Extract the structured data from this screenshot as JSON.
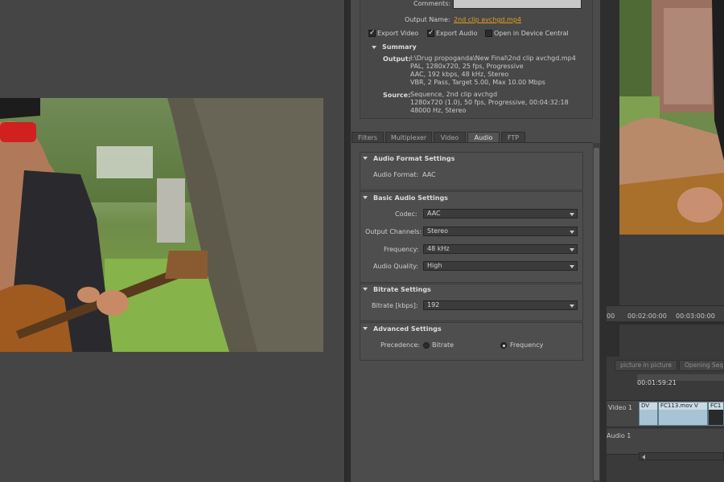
{
  "dialog": {
    "comments_label": "Comments:",
    "comments_value": "",
    "output_name_label": "Output Name:",
    "output_name_value": "2nd clip avchgd.mp4",
    "export_video_label": "Export Video",
    "export_video_checked": true,
    "export_audio_label": "Export Audio",
    "export_audio_checked": true,
    "device_central_label": "Open in Device Central",
    "device_central_checked": false,
    "summary": {
      "title": "Summary",
      "output_label": "Output:",
      "output_lines": [
        "I:\\Drug propoganda\\New Final\\2nd clip avchgd.mp4",
        "PAL, 1280x720, 25 fps, Progressive",
        "AAC, 192 kbps, 48 kHz, Stereo",
        "VBR, 2 Pass, Target 5.00, Max 10.00 Mbps"
      ],
      "source_label": "Source:",
      "source_lines": [
        "Sequence, 2nd clip avchgd",
        "1280x720 (1.0), 50 fps, Progressive, 00:04:32:18",
        "48000 Hz, Stereo"
      ]
    },
    "tabs": [
      "Filters",
      "Multiplexer",
      "Video",
      "Audio",
      "FTP"
    ],
    "active_tab": "Audio",
    "audio_format": {
      "title": "Audio Format Settings",
      "label": "Audio Format:",
      "value": "AAC"
    },
    "basic_audio": {
      "title": "Basic Audio Settings",
      "codec_label": "Codec:",
      "codec_value": "AAC",
      "channels_label": "Output Channels:",
      "channels_value": "Stereo",
      "frequency_label": "Frequency:",
      "frequency_value": "48 kHz",
      "quality_label": "Audio Quality:",
      "quality_value": "High"
    },
    "bitrate": {
      "title": "Bitrate Settings",
      "label": "Bitrate [kbps]:",
      "value": "192"
    },
    "advanced": {
      "title": "Advanced Settings",
      "precedence_label": "Precedence:",
      "option_bitrate": "Bitrate",
      "option_frequency": "Frequency",
      "selected": "Frequency"
    }
  },
  "timeline": {
    "ruler_ticks": [
      "00",
      "00:02:00:00",
      "00:03:00:00"
    ],
    "sequence_tabs": [
      "picture in picture",
      "Opening Seq"
    ],
    "timecode": "00:01:59:21",
    "video_track_label": "Video 1",
    "audio_track_label": "Audio 1",
    "clips": [
      "DV",
      "FC113.mov V",
      "FC1"
    ]
  },
  "colors": {
    "panel_bg": "#4b4b4b",
    "link_orange": "#e0a020",
    "clip_blue": "#a8c4d4"
  }
}
